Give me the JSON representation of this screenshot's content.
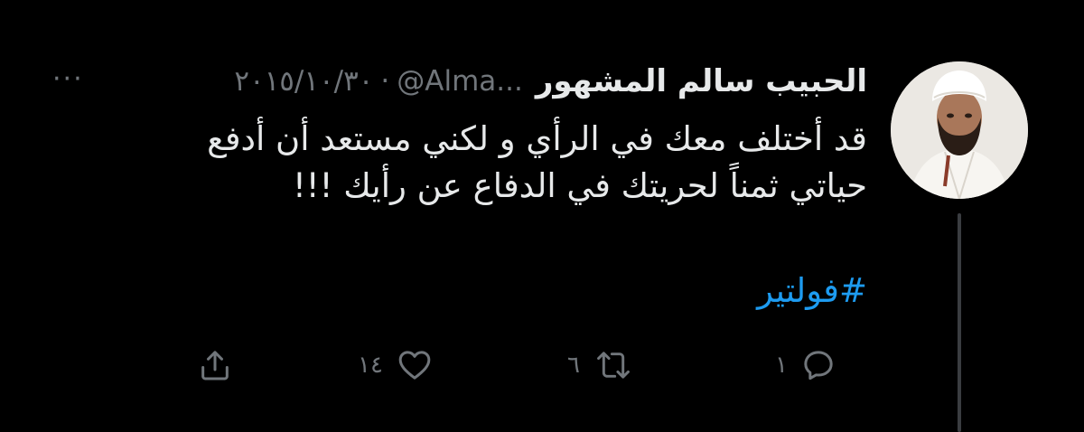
{
  "tweet": {
    "display_name": "الحبيب سالم المشهور",
    "handle": "@Alma...",
    "separator": "·",
    "date": "٢٠١٥/١٠/٣٠",
    "more_label": "···",
    "text_line_1": "قد أختلف معك في الرأي و لكني مستعد أن أدفع",
    "text_line_2": "حياتي ثمناً لحريتك في الدفاع عن رأيك !!!",
    "hashtag": "#فولتير",
    "avatar_icon": "profile-photo"
  },
  "actions": {
    "reply": {
      "icon": "reply-icon",
      "count": "١"
    },
    "retweet": {
      "icon": "retweet-icon",
      "count": "٦"
    },
    "like": {
      "icon": "heart-icon",
      "count": "١٤"
    },
    "share": {
      "icon": "share-icon"
    }
  },
  "colors": {
    "background": "#000000",
    "text": "#e7e9ea",
    "muted": "#71767b",
    "link": "#1d9bf0",
    "thread_line": "#3a3d41"
  }
}
